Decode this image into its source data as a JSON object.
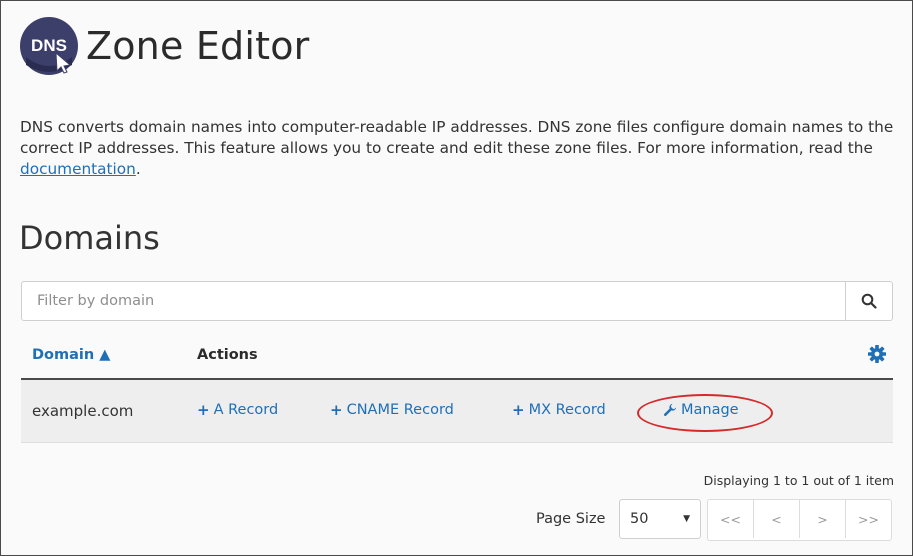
{
  "app": {
    "title": "Zone Editor",
    "logo_text": "DNS",
    "logo_icon": "dns-globe-cursor-icon"
  },
  "description": {
    "text_before_link": "DNS converts domain names into computer-readable IP addresses. DNS zone files configure domain names to the correct IP addresses. This feature allows you to create and edit these zone files. For more information, read the ",
    "link_text": "documentation",
    "text_after_link": "."
  },
  "domains_section": {
    "title": "Domains",
    "filter": {
      "placeholder": "Filter by domain",
      "value": "",
      "search_icon": "search-icon"
    },
    "table": {
      "columns": {
        "domain": "Domain",
        "domain_sort_indicator": "▲",
        "actions": "Actions",
        "settings_icon": "gear-icon"
      },
      "rows": [
        {
          "domain": "example.com",
          "actions": [
            {
              "icon": "+",
              "label": "A Record"
            },
            {
              "icon": "+",
              "label": "CNAME Record"
            },
            {
              "icon": "+",
              "label": "MX Record"
            },
            {
              "icon": "wrench-icon",
              "label": "Manage"
            }
          ]
        }
      ]
    },
    "pagination": {
      "display_text": "Displaying 1 to 1 out of 1 item",
      "page_size_label": "Page Size",
      "page_size_value": "50",
      "buttons": [
        "<<",
        "<",
        ">",
        ">>"
      ]
    }
  },
  "colors": {
    "link_blue": "#1f6fb7",
    "highlight_red": "#d42a2a",
    "logo_dark": "#3d3f6b"
  }
}
